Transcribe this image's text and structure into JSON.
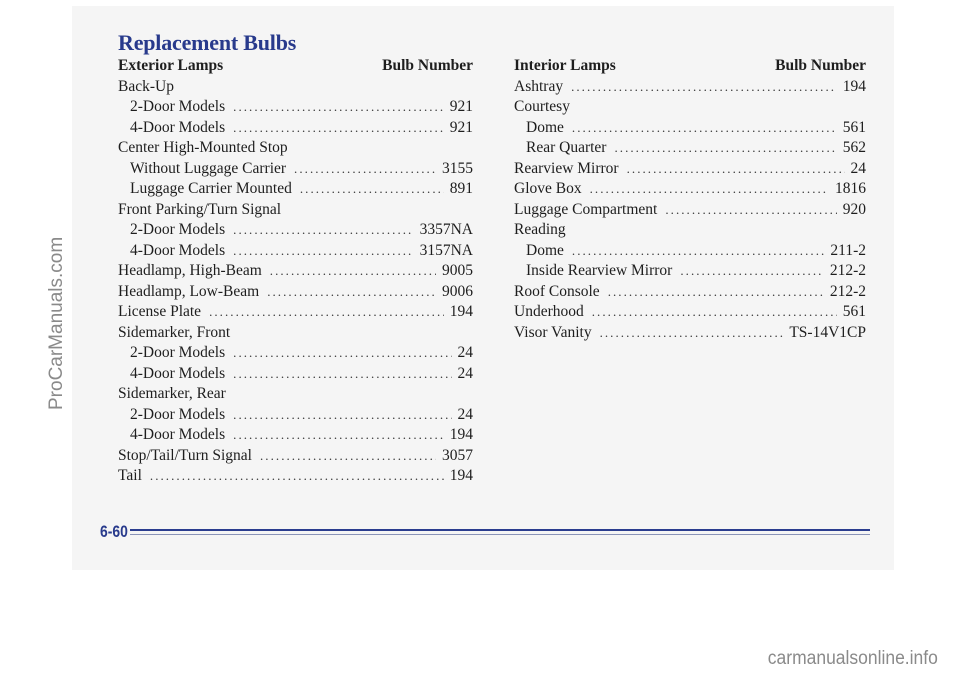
{
  "title": "Replacement Bulbs",
  "page_number": "6-60",
  "exterior": {
    "heading": "Exterior Lamps",
    "column_heading": "Bulb Number",
    "rows": [
      {
        "label": "Back-Up",
        "value": "",
        "indent": false
      },
      {
        "label": "2-Door Models",
        "value": "921",
        "indent": true
      },
      {
        "label": "4-Door Models",
        "value": "921",
        "indent": true
      },
      {
        "label": "Center High-Mounted Stop",
        "value": "",
        "indent": false
      },
      {
        "label": "Without Luggage Carrier",
        "value": "3155",
        "indent": true
      },
      {
        "label": "Luggage Carrier Mounted",
        "value": "891",
        "indent": true
      },
      {
        "label": "Front Parking/Turn Signal",
        "value": "",
        "indent": false
      },
      {
        "label": "2-Door Models",
        "value": "3357NA",
        "indent": true
      },
      {
        "label": "4-Door Models",
        "value": "3157NA",
        "indent": true
      },
      {
        "label": "Headlamp, High-Beam",
        "value": "9005",
        "indent": false
      },
      {
        "label": "Headlamp, Low-Beam",
        "value": "9006",
        "indent": false
      },
      {
        "label": "License Plate",
        "value": "194",
        "indent": false
      },
      {
        "label": "Sidemarker, Front",
        "value": "",
        "indent": false
      },
      {
        "label": "2-Door Models",
        "value": "24",
        "indent": true
      },
      {
        "label": "4-Door Models",
        "value": "24",
        "indent": true
      },
      {
        "label": "Sidemarker, Rear",
        "value": "",
        "indent": false
      },
      {
        "label": "2-Door Models",
        "value": "24",
        "indent": true
      },
      {
        "label": "4-Door Models",
        "value": "194",
        "indent": true
      },
      {
        "label": "Stop/Tail/Turn Signal",
        "value": "3057",
        "indent": false
      },
      {
        "label": "Tail",
        "value": "194",
        "indent": false
      }
    ]
  },
  "interior": {
    "heading": "Interior Lamps",
    "column_heading": "Bulb Number",
    "rows": [
      {
        "label": "Ashtray",
        "value": "194",
        "indent": false
      },
      {
        "label": "Courtesy",
        "value": "",
        "indent": false
      },
      {
        "label": "Dome",
        "value": "561",
        "indent": true
      },
      {
        "label": "Rear Quarter",
        "value": "562",
        "indent": true
      },
      {
        "label": "Rearview Mirror",
        "value": "24",
        "indent": false
      },
      {
        "label": "Glove Box",
        "value": "1816",
        "indent": false
      },
      {
        "label": "Luggage Compartment",
        "value": "920",
        "indent": false
      },
      {
        "label": "Reading",
        "value": "",
        "indent": false
      },
      {
        "label": "Dome",
        "value": "211-2",
        "indent": true
      },
      {
        "label": "Inside Rearview Mirror",
        "value": "212-2",
        "indent": true
      },
      {
        "label": "Roof Console",
        "value": "212-2",
        "indent": false
      },
      {
        "label": "Underhood",
        "value": "561",
        "indent": false
      },
      {
        "label": "Visor Vanity",
        "value": "TS-14V1CP",
        "indent": false
      }
    ]
  },
  "watermarks": {
    "left": "ProCarManuals.com",
    "bottom": "carmanualsonline.info"
  },
  "colors": {
    "heading_blue": "#283a8c",
    "rule_blue": "#2b3d8f",
    "page_bg": "#f5f5f5",
    "watermark_gray": "#8a8a8a"
  }
}
